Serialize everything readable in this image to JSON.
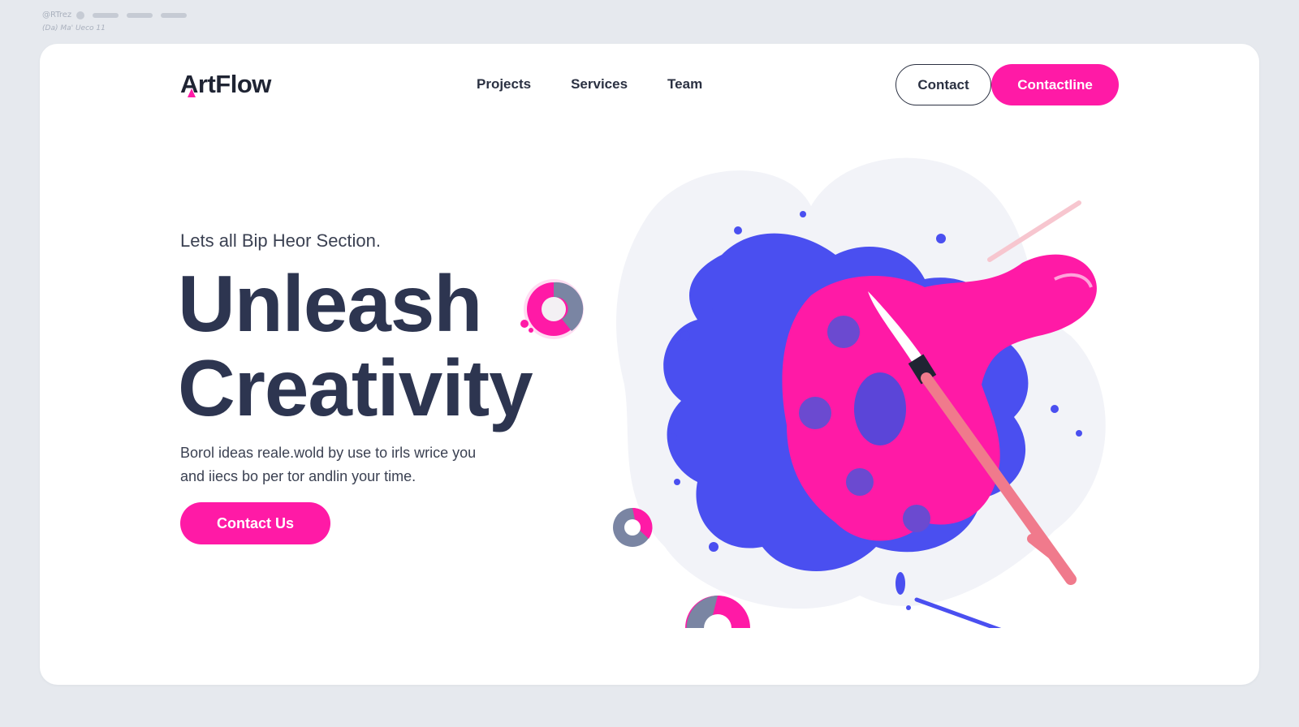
{
  "system": {
    "line1": "@RTrez",
    "line2": "(Da) Ma' Ueco 11"
  },
  "nav": {
    "logo": "ArtFlow",
    "links": [
      "Projects",
      "Services",
      "Team"
    ],
    "contact": "Contact",
    "primary": "Contactline"
  },
  "hero": {
    "eyebrow": "Lets all Bip Heor Section.",
    "headline_line1": "Unleash",
    "headline_line2": "Creativity",
    "body_line1": "Borol ideas reale.wold by use to irls wrice you",
    "body_line2": "and iiecs bo per tor andlin your time.",
    "cta": "Contact Us"
  },
  "colors": {
    "accent": "#ff1aa6",
    "blue": "#4a4ff0",
    "dark": "#2d3550",
    "background": "#e6e9ee"
  },
  "icons": [
    "donut-icon",
    "paint-palette-illustration",
    "paintbrush-icon"
  ]
}
